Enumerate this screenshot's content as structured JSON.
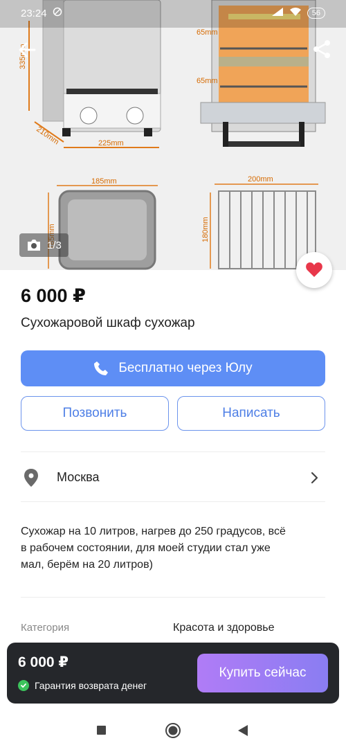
{
  "status_bar": {
    "time": "23:24",
    "battery": "56"
  },
  "gallery": {
    "photo_counter": "1/3",
    "dimensions": {
      "height": "335mm",
      "depth": "210mm",
      "width": "225mm",
      "gap_top": "65mm",
      "gap_bottom": "65mm",
      "tray_width": "185mm",
      "tray_height": "185mm",
      "rack_width": "200mm",
      "rack_height": "180mm"
    }
  },
  "listing": {
    "price": "6 000 ₽",
    "title": "Сухожаровой шкаф сухожар"
  },
  "actions": {
    "free_call_label": "Бесплатно через Юлу",
    "call_label": "Позвонить",
    "write_label": "Написать"
  },
  "location": {
    "city": "Москва"
  },
  "description": "Сухожар на 10 литров, нагрев до 250 градусов, всё\nв рабочем состоянии, для моей студии стал уже\nмал, берём на 20 литров)",
  "details": {
    "category_label": "Категория",
    "category_value": "Красота и здоровье"
  },
  "buy_bar": {
    "price": "6 000 ₽",
    "guarantee": "Гарантия возврата денег",
    "buy_label": "Купить сейчас"
  },
  "colors": {
    "primary": "#5e8ef5",
    "buy_gradient_start": "#b07cf6",
    "buy_gradient_end": "#8a7df2",
    "favorite": "#e8374a",
    "guarantee_check": "#3cc35c"
  },
  "icons": {
    "back": "arrow-left-icon",
    "share": "share-icon",
    "camera": "camera-icon",
    "favorite": "heart-icon",
    "phone": "phone-icon",
    "location": "map-pin-icon",
    "chevron": "chevron-right-icon",
    "check": "check-icon"
  }
}
